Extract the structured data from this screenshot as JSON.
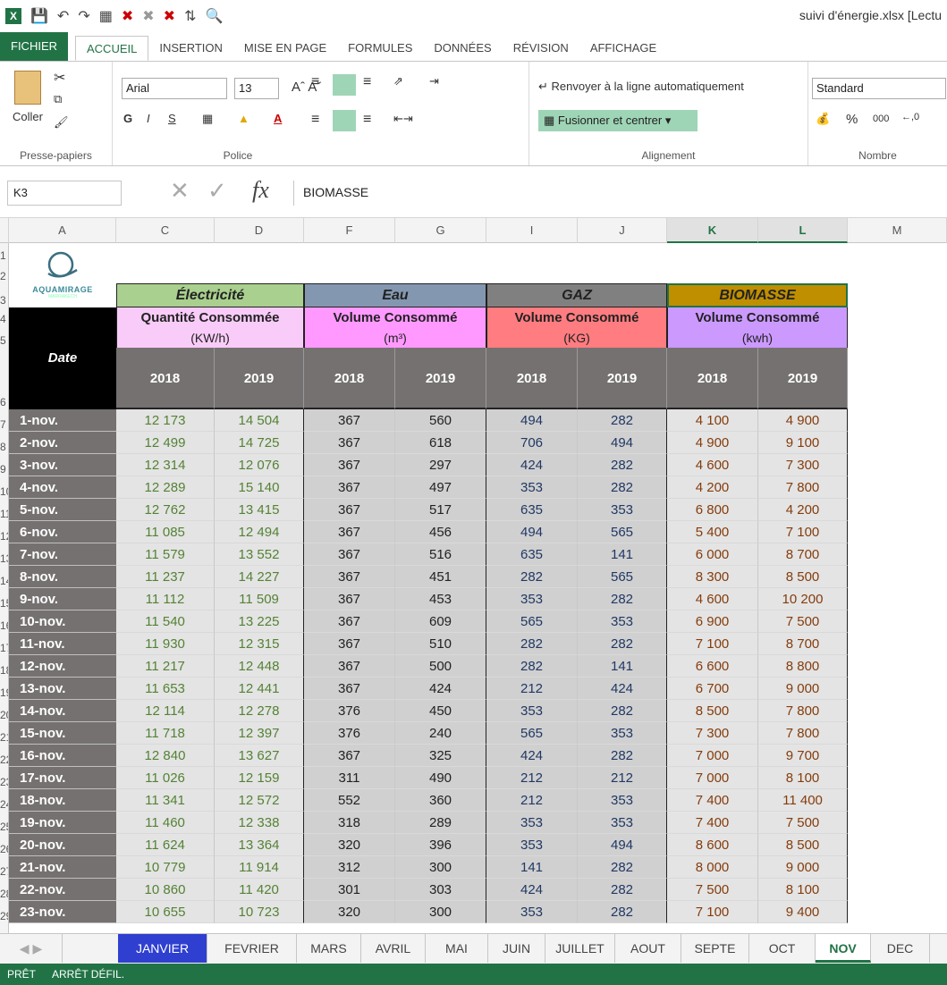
{
  "app": {
    "title": "suivi d'énergie.xlsx [Lectu",
    "logo_letter": "X"
  },
  "ribbon_tabs": [
    "FICHIER",
    "ACCUEIL",
    "INSERTION",
    "MISE EN PAGE",
    "FORMULES",
    "DONNÉES",
    "RÉVISION",
    "AFFICHAGE"
  ],
  "ribbon": {
    "paste_label": "Coller",
    "clipboard_label": "Presse-papiers",
    "font_name": "Arial",
    "font_size": "13",
    "bold": "G",
    "italic": "I",
    "underline": "S",
    "font_group_label": "Police",
    "wrap_text": "Renvoyer à la ligne automatiquement",
    "merge_center": "Fusionner et centrer",
    "alignment_label": "Alignement",
    "number_format": "Standard",
    "percent": "%",
    "thousands": "000",
    "number_label": "Nombre"
  },
  "formula_bar": {
    "name_box": "K3",
    "fx": "fx",
    "content": "BIOMASSE"
  },
  "columns": [
    "A",
    "C",
    "D",
    "F",
    "G",
    "I",
    "J",
    "K",
    "L",
    "M"
  ],
  "rows": [
    "1",
    "2",
    "3",
    "4",
    "5",
    "6",
    "7",
    "8",
    "9",
    "10",
    "11",
    "12",
    "13",
    "14",
    "15",
    "16",
    "17",
    "18",
    "19",
    "20",
    "21",
    "22",
    "23",
    "24",
    "25",
    "26",
    "27",
    "28",
    "29"
  ],
  "logo": {
    "text": "AQUAMIRAGE",
    "sub": "MARRAKECH"
  },
  "table": {
    "date_header": "Date",
    "groups": [
      {
        "name": "Électricité",
        "measure": "Quantité Consommée",
        "unit": "(KW/h)",
        "color": "#a9d08e",
        "sub_bg": "#f8cbf8",
        "val_color": "#548235"
      },
      {
        "name": "Eau",
        "measure": "Volume Consommé",
        "unit": "(m³)",
        "color": "#8497b0",
        "sub_bg": "#ff99ff",
        "val_color": "#222222"
      },
      {
        "name": "GAZ",
        "measure": "Volume Consommé",
        "unit": "(KG)",
        "color": "#808080",
        "sub_bg": "#ff7c80",
        "val_color": "#203864"
      },
      {
        "name": "BIOMASSE",
        "measure": "Volume Consommé",
        "unit": "(kwh)",
        "color": "#bf8f00",
        "sub_bg": "#cc99ff",
        "val_color": "#843c0c"
      }
    ],
    "years": [
      "2018",
      "2019"
    ],
    "dates": [
      "1-nov.",
      "2-nov.",
      "3-nov.",
      "4-nov.",
      "5-nov.",
      "6-nov.",
      "7-nov.",
      "8-nov.",
      "9-nov.",
      "10-nov.",
      "11-nov.",
      "12-nov.",
      "13-nov.",
      "14-nov.",
      "15-nov.",
      "16-nov.",
      "17-nov.",
      "18-nov.",
      "19-nov.",
      "20-nov.",
      "21-nov.",
      "22-nov.",
      "23-nov."
    ],
    "data": [
      [
        "12 173",
        "14 504",
        "367",
        "560",
        "494",
        "282",
        "4 100",
        "4 900"
      ],
      [
        "12 499",
        "14 725",
        "367",
        "618",
        "706",
        "494",
        "4 900",
        "9 100"
      ],
      [
        "12 314",
        "12 076",
        "367",
        "297",
        "424",
        "282",
        "4 600",
        "7 300"
      ],
      [
        "12 289",
        "15 140",
        "367",
        "497",
        "353",
        "282",
        "4 200",
        "7 800"
      ],
      [
        "12 762",
        "13 415",
        "367",
        "517",
        "635",
        "353",
        "6 800",
        "4 200"
      ],
      [
        "11 085",
        "12 494",
        "367",
        "456",
        "494",
        "565",
        "5 400",
        "7 100"
      ],
      [
        "11 579",
        "13 552",
        "367",
        "516",
        "635",
        "141",
        "6 000",
        "8 700"
      ],
      [
        "11 237",
        "14 227",
        "367",
        "451",
        "282",
        "565",
        "8 300",
        "8 500"
      ],
      [
        "11 112",
        "11 509",
        "367",
        "453",
        "353",
        "282",
        "4 600",
        "10 200"
      ],
      [
        "11 540",
        "13 225",
        "367",
        "609",
        "565",
        "353",
        "6 900",
        "7 500"
      ],
      [
        "11 930",
        "12 315",
        "367",
        "510",
        "282",
        "282",
        "7 100",
        "8 700"
      ],
      [
        "11 217",
        "12 448",
        "367",
        "500",
        "282",
        "141",
        "6 600",
        "8 800"
      ],
      [
        "11 653",
        "12 441",
        "367",
        "424",
        "212",
        "424",
        "6 700",
        "9 000"
      ],
      [
        "12 114",
        "12 278",
        "376",
        "450",
        "353",
        "282",
        "8 500",
        "7 800"
      ],
      [
        "11 718",
        "12 397",
        "376",
        "240",
        "565",
        "353",
        "7 300",
        "7 800"
      ],
      [
        "12 840",
        "13 627",
        "367",
        "325",
        "424",
        "282",
        "7 000",
        "9 700"
      ],
      [
        "11 026",
        "12 159",
        "311",
        "490",
        "212",
        "212",
        "7 000",
        "8 100"
      ],
      [
        "11 341",
        "12 572",
        "552",
        "360",
        "212",
        "353",
        "7 400",
        "11 400"
      ],
      [
        "11 460",
        "12 338",
        "318",
        "289",
        "353",
        "353",
        "7 400",
        "7 500"
      ],
      [
        "11 624",
        "13 364",
        "320",
        "396",
        "353",
        "494",
        "8 600",
        "8 500"
      ],
      [
        "10 779",
        "11 914",
        "312",
        "300",
        "141",
        "282",
        "8 000",
        "9 000"
      ],
      [
        "10 860",
        "11 420",
        "301",
        "303",
        "424",
        "282",
        "7 500",
        "8 100"
      ],
      [
        "10 655",
        "10 723",
        "320",
        "300",
        "353",
        "282",
        "7 100",
        "9 400"
      ]
    ]
  },
  "sheet_tabs": [
    "JANVIER",
    "FEVRIER",
    "MARS",
    "AVRIL",
    "MAI",
    "JUIN",
    "JUILLET",
    "AOUT",
    "SEPTE",
    "OCT",
    "NOV",
    "DEC"
  ],
  "active_sheet": "NOV",
  "status": [
    "PRÊT",
    "ARRÊT DÉFIL."
  ]
}
